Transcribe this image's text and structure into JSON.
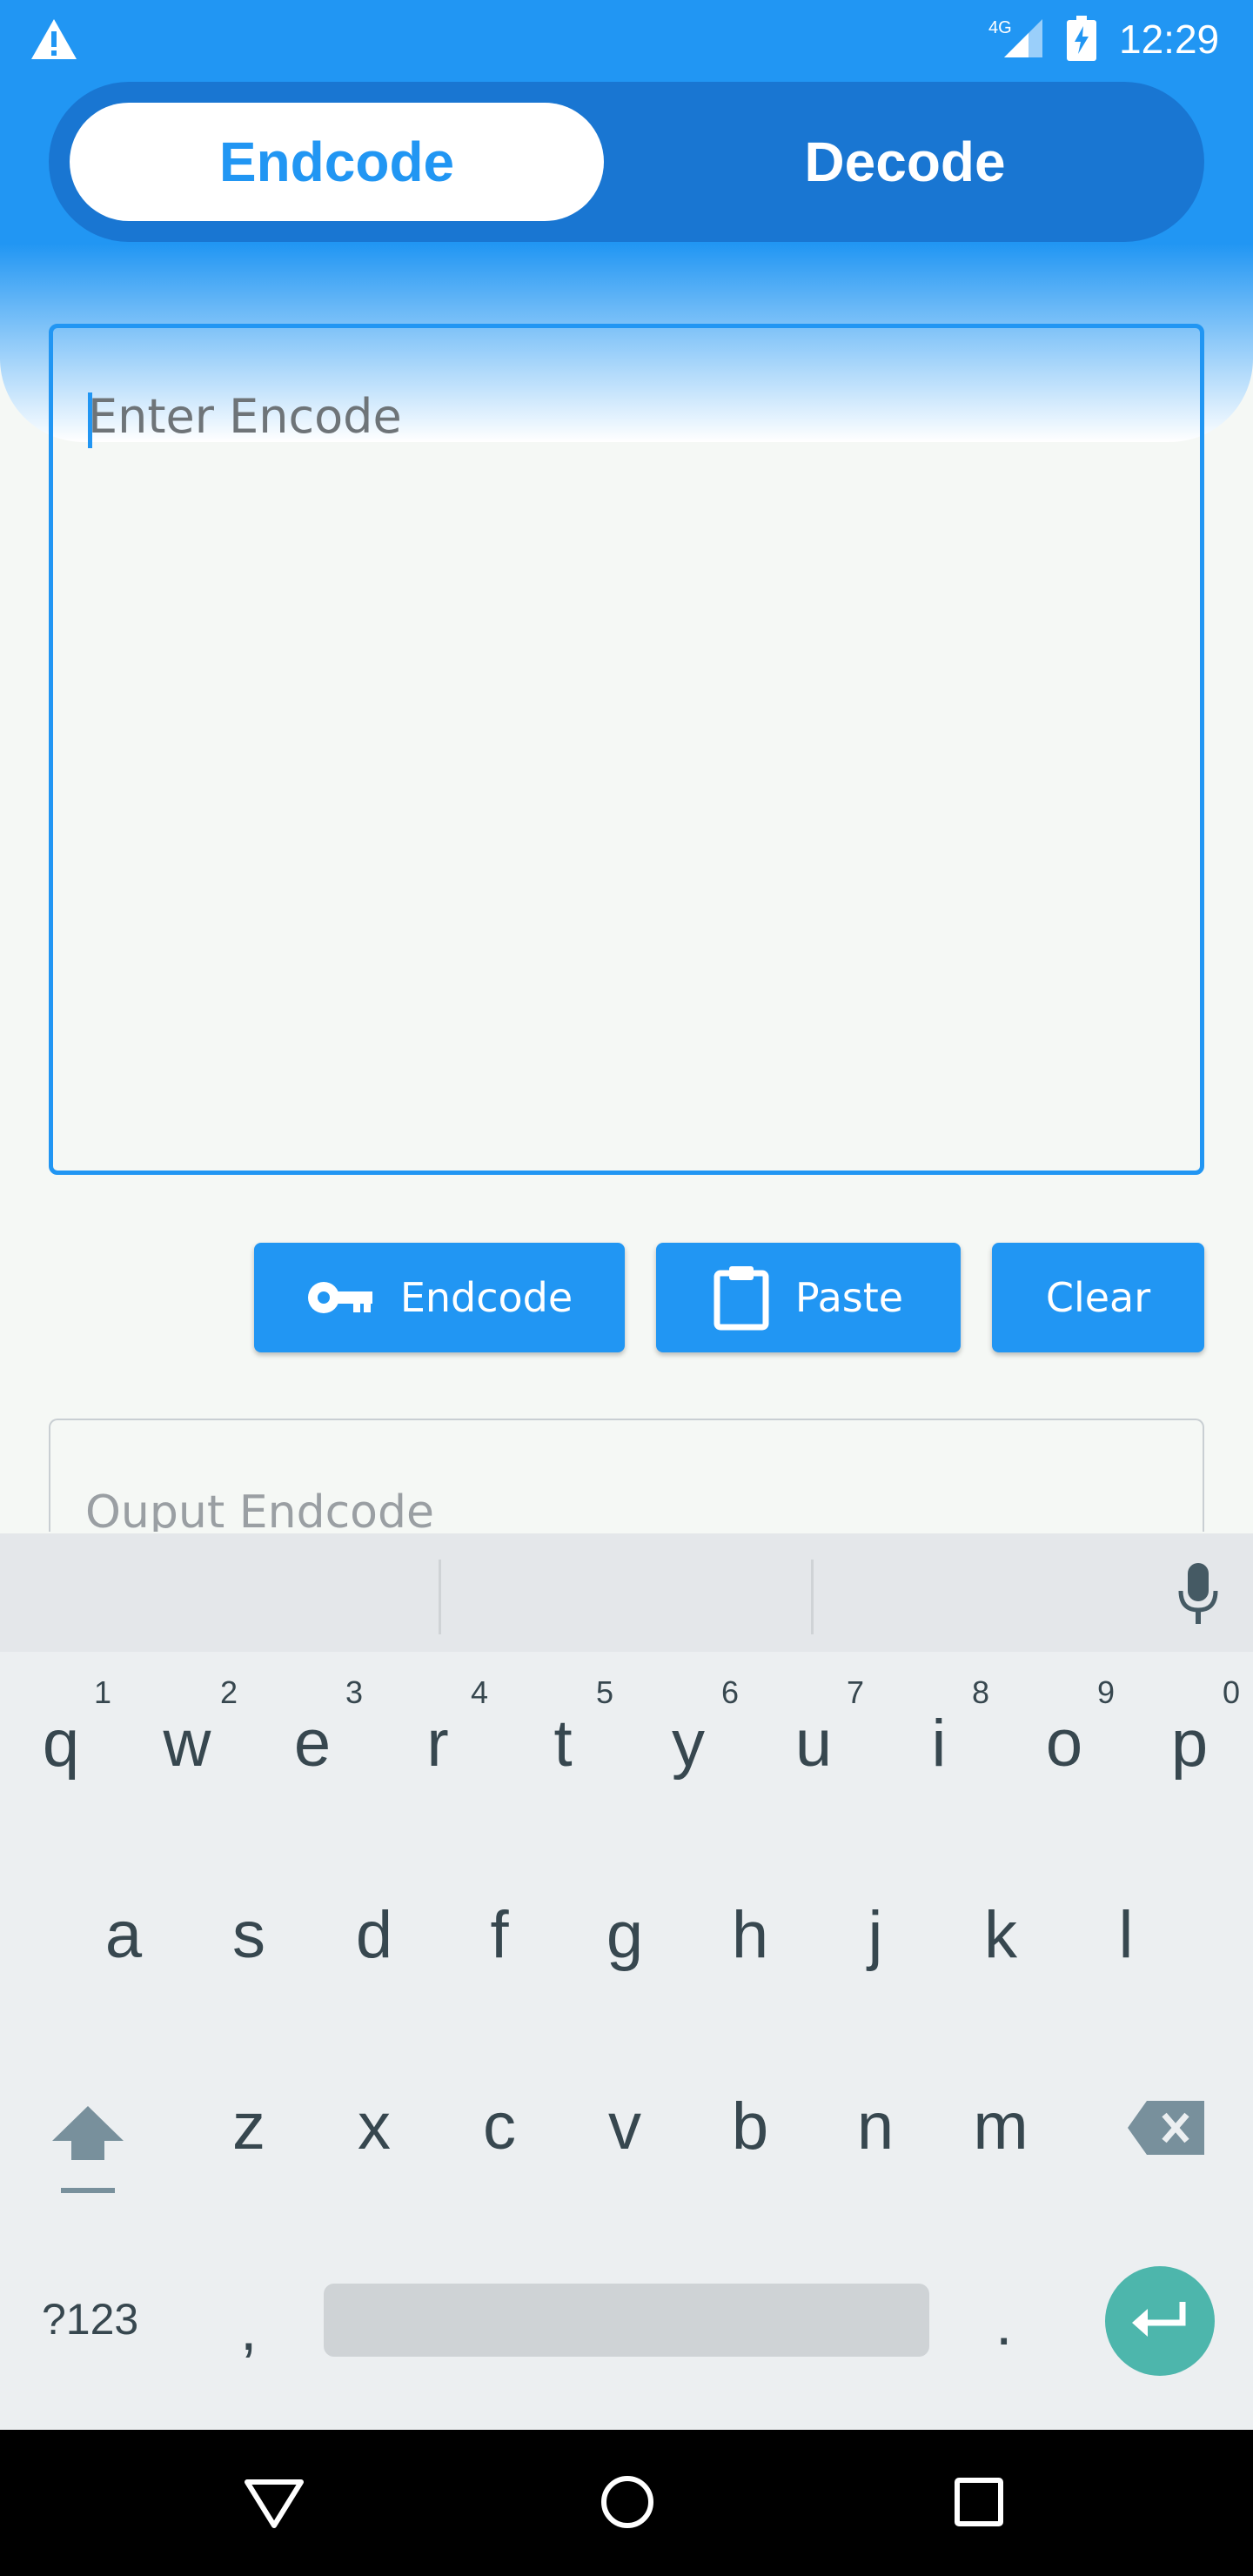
{
  "status_bar": {
    "network": "4G",
    "time": "12:29"
  },
  "tabs": {
    "encode_label": "Endcode",
    "decode_label": "Decode",
    "active": "Endcode"
  },
  "input": {
    "placeholder": "Enter Encode",
    "value": ""
  },
  "actions": {
    "encode_label": "Endcode",
    "paste_label": "Paste",
    "clear_label": "Clear"
  },
  "output": {
    "placeholder": "Ouput Endcode"
  },
  "keyboard": {
    "row1": [
      {
        "key": "q",
        "hint": "1"
      },
      {
        "key": "w",
        "hint": "2"
      },
      {
        "key": "e",
        "hint": "3"
      },
      {
        "key": "r",
        "hint": "4"
      },
      {
        "key": "t",
        "hint": "5"
      },
      {
        "key": "y",
        "hint": "6"
      },
      {
        "key": "u",
        "hint": "7"
      },
      {
        "key": "i",
        "hint": "8"
      },
      {
        "key": "o",
        "hint": "9"
      },
      {
        "key": "p",
        "hint": "0"
      }
    ],
    "row2": [
      "a",
      "s",
      "d",
      "f",
      "g",
      "h",
      "j",
      "k",
      "l"
    ],
    "row3": [
      "z",
      "x",
      "c",
      "v",
      "b",
      "n",
      "m"
    ],
    "symbols_label": "?123",
    "comma": ",",
    "period": "."
  },
  "colors": {
    "primary": "#2196f3",
    "primary_dark": "#1976d2",
    "enter_key": "#4db6ac"
  }
}
